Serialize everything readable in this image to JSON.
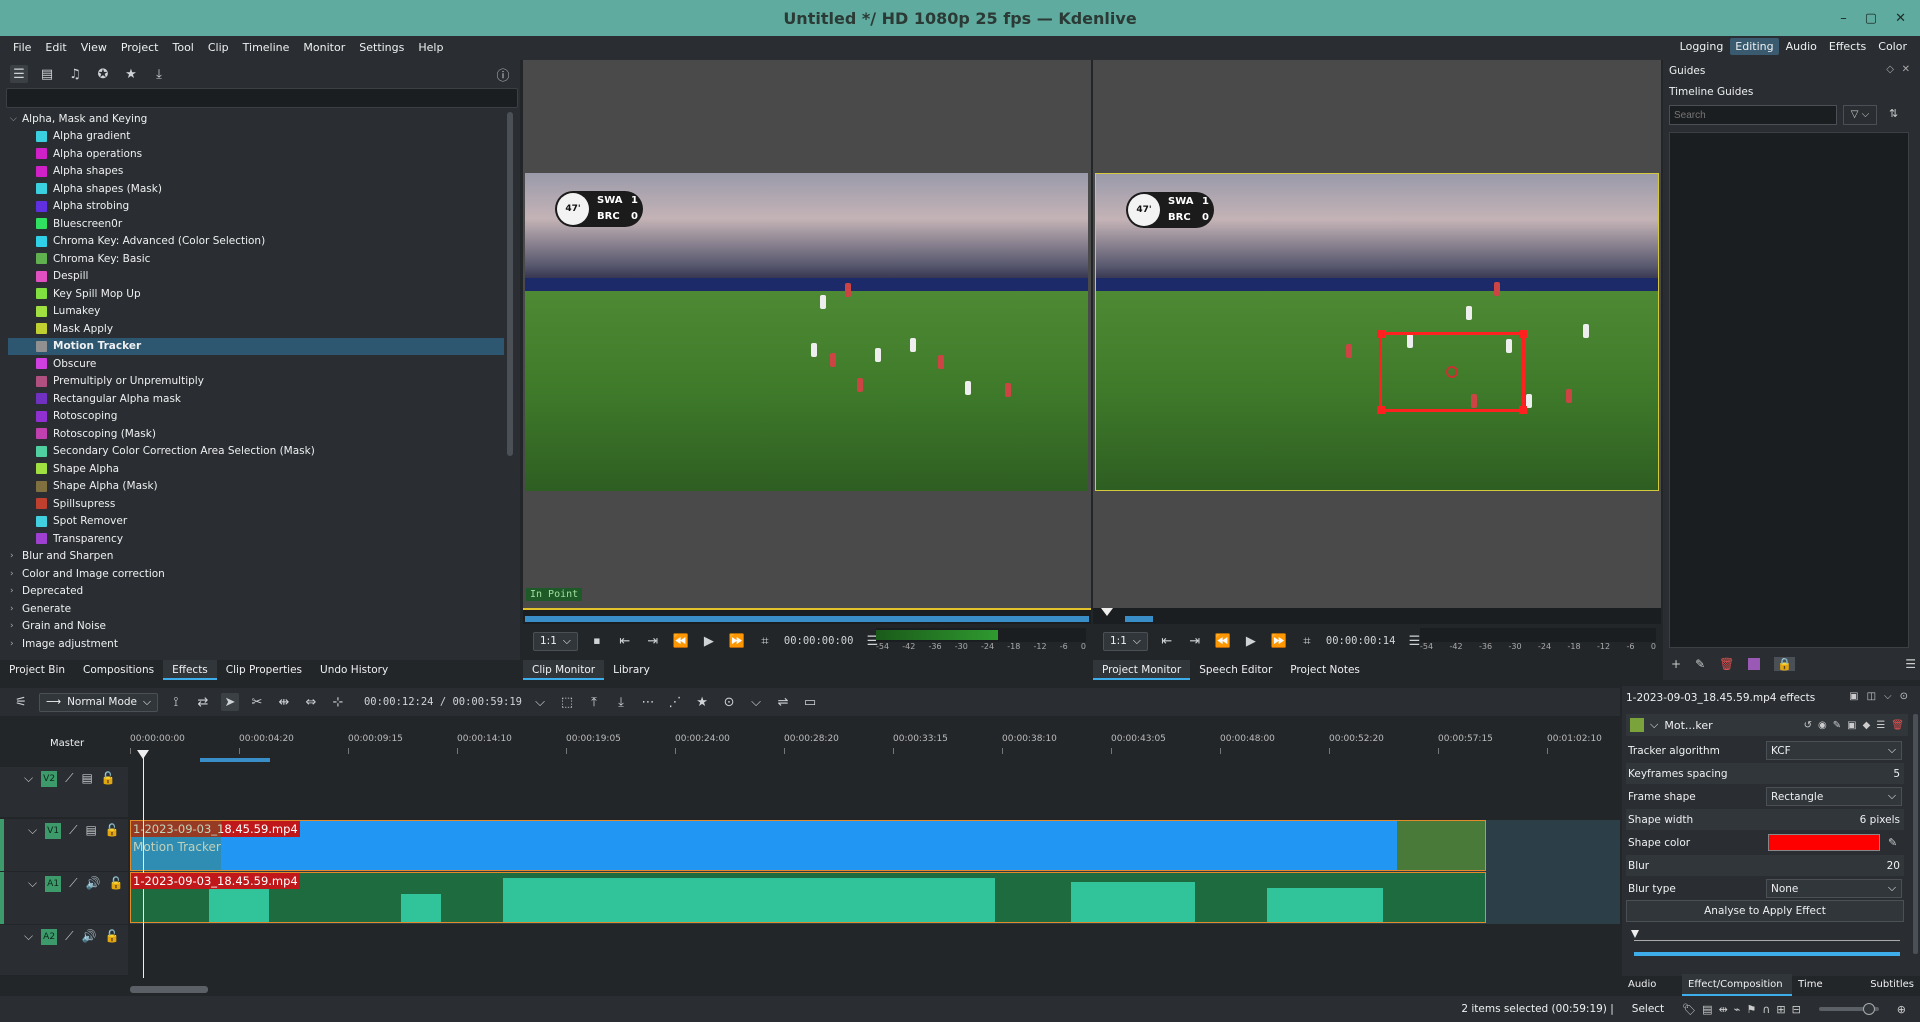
{
  "window": {
    "title": "Untitled */ HD 1080p 25 fps — Kdenlive",
    "controls": [
      "–",
      "▢",
      "✕"
    ]
  },
  "menu": [
    "File",
    "Edit",
    "View",
    "Project",
    "Tool",
    "Clip",
    "Timeline",
    "Monitor",
    "Settings",
    "Help"
  ],
  "workspaces": [
    {
      "label": "Logging",
      "active": false
    },
    {
      "label": "Editing",
      "active": true
    },
    {
      "label": "Audio",
      "active": false
    },
    {
      "label": "Effects",
      "active": false
    },
    {
      "label": "Color",
      "active": false
    }
  ],
  "effects_panel": {
    "categories_before": [],
    "open_category": "Alpha, Mask and Keying",
    "items": [
      {
        "label": "Alpha gradient",
        "color": "#3ad0e0"
      },
      {
        "label": "Alpha operations",
        "color": "#d020c8"
      },
      {
        "label": "Alpha shapes",
        "color": "#d020c8"
      },
      {
        "label": "Alpha shapes (Mask)",
        "color": "#3ad0e0"
      },
      {
        "label": "Alpha strobing",
        "color": "#6030e0"
      },
      {
        "label": "Bluescreen0r",
        "color": "#30e060"
      },
      {
        "label": "Chroma Key: Advanced (Color Selection)",
        "color": "#30d0e8"
      },
      {
        "label": "Chroma Key: Basic",
        "color": "#60b050"
      },
      {
        "label": "Despill",
        "color": "#e050c0"
      },
      {
        "label": "Key Spill Mop Up",
        "color": "#80e040"
      },
      {
        "label": "Lumakey",
        "color": "#a0e040"
      },
      {
        "label": "Mask Apply",
        "color": "#c0d030"
      },
      {
        "label": "Motion Tracker",
        "color": "#909090",
        "selected": true
      },
      {
        "label": "Obscure",
        "color": "#d040e0"
      },
      {
        "label": "Premultiply or Unpremultiply",
        "color": "#b05080"
      },
      {
        "label": "Rectangular Alpha mask",
        "color": "#7030c0"
      },
      {
        "label": "Rotoscoping",
        "color": "#9030d0"
      },
      {
        "label": "Rotoscoping (Mask)",
        "color": "#c040b0"
      },
      {
        "label": "Secondary Color Correction Area Selection (Mask)",
        "color": "#50d0a0"
      },
      {
        "label": "Shape Alpha",
        "color": "#a0e040"
      },
      {
        "label": "Shape Alpha (Mask)",
        "color": "#807040"
      },
      {
        "label": "Spillsupress",
        "color": "#c04030"
      },
      {
        "label": "Spot Remover",
        "color": "#40d0e0"
      },
      {
        "label": "Transparency",
        "color": "#a040d0"
      }
    ],
    "categories_after": [
      "Blur and Sharpen",
      "Color and Image correction",
      "Deprecated",
      "Generate",
      "Grain and Noise",
      "Image adjustment"
    ]
  },
  "left_tabs": [
    {
      "label": "Project Bin",
      "active": false
    },
    {
      "label": "Compositions",
      "active": false
    },
    {
      "label": "Effects",
      "active": true
    },
    {
      "label": "Clip Properties",
      "active": false
    },
    {
      "label": "Undo History",
      "active": false
    }
  ],
  "clip_monitor": {
    "in_point_label": "In Point",
    "zoom": "1:1",
    "timecode": "00:00:00:00",
    "meter_scale": [
      "-54",
      "-42",
      "-36",
      "-30",
      "-24",
      "-18",
      "-12",
      "-6",
      "0"
    ],
    "tabs": [
      {
        "label": "Clip Monitor",
        "active": true
      },
      {
        "label": "Library",
        "active": false
      }
    ]
  },
  "project_monitor": {
    "zoom": "1:1",
    "timecode": "00:00:00:14",
    "meter_scale": [
      "-54",
      "-42",
      "-36",
      "-30",
      "-24",
      "-18",
      "-12",
      "-6",
      "0"
    ],
    "tabs": [
      {
        "label": "Project Monitor",
        "active": true
      },
      {
        "label": "Speech Editor",
        "active": false
      },
      {
        "label": "Project Notes",
        "active": false
      }
    ]
  },
  "scoreboard": {
    "clock": "47'",
    "home": "SWA",
    "away": "BRC",
    "home_score": "1",
    "away_score": "0"
  },
  "guides": {
    "title": "Guides",
    "subtitle": "Timeline Guides",
    "search_placeholder": "Search"
  },
  "timeline": {
    "mode": "Normal Mode",
    "position": "00:00:12:24 / 00:00:59:19",
    "master_label": "Master",
    "ruler": [
      "00:00:00:00",
      "00:00:04:20",
      "00:00:09:15",
      "00:00:14:10",
      "00:00:19:05",
      "00:00:24:00",
      "00:00:28:20",
      "00:00:33:15",
      "00:00:38:10",
      "00:00:43:05",
      "00:00:48:00",
      "00:00:52:20",
      "00:00:57:15",
      "00:01:02:10"
    ],
    "tracks": [
      {
        "label": "V2"
      },
      {
        "label": "V1"
      },
      {
        "label": "A1"
      },
      {
        "label": "A2"
      }
    ],
    "video_clip": {
      "name": "1-2023-09-03_18.45.59.mp4",
      "effect": "Motion Tracker"
    },
    "audio_clip": {
      "name": "1-2023-09-03_18.45.59.mp4"
    }
  },
  "effect_stack": {
    "header": "1-2023-09-03_18.45.59.mp4 effects",
    "effect_name": "Mot...ker",
    "params": [
      {
        "label": "Tracker algorithm",
        "value": "KCF",
        "kind": "combo"
      },
      {
        "label": "Keyframes spacing",
        "value": "5",
        "kind": "slider"
      },
      {
        "label": "Frame shape",
        "value": "Rectangle",
        "kind": "combo"
      },
      {
        "label": "Shape width",
        "value": "6 pixels",
        "kind": "slider"
      },
      {
        "label": "Shape color",
        "value": "",
        "kind": "color",
        "color": "#ff0000"
      },
      {
        "label": "Blur",
        "value": "20",
        "kind": "slider"
      },
      {
        "label": "Blur type",
        "value": "None",
        "kind": "combo"
      }
    ],
    "analyse_button": "Analyse to Apply Effect"
  },
  "bottom_right_tabs": [
    {
      "label": "Audio Mi...",
      "active": false
    },
    {
      "label": "Effect/Composition ...",
      "active": true
    },
    {
      "label": "Time Rema...",
      "active": false
    },
    {
      "label": "Subtitles",
      "active": false
    }
  ],
  "status": {
    "selection": "2 items selected (00:59:19) |",
    "tool": "Select"
  }
}
